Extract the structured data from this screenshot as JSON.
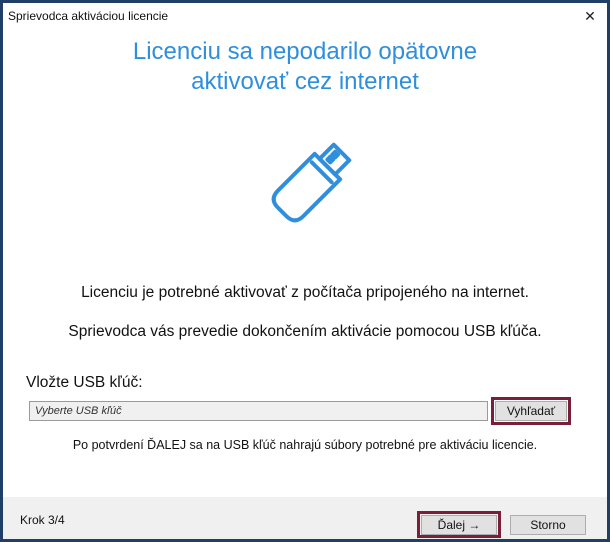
{
  "window": {
    "title": "Sprievodca aktiváciou licencie",
    "close_glyph": "✕"
  },
  "headline": {
    "line1": "Licenciu sa nepodarilo opätovne",
    "line2": "aktivovať cez internet"
  },
  "illustration": {
    "icon": "usb-drive-icon",
    "color": "#2f8fdc"
  },
  "info": {
    "line1": "Licenciu je potrebné aktivovať z počítača pripojeného na internet.",
    "line2": "Sprievodca vás prevedie dokončením aktivácie pomocou USB kľúča."
  },
  "usb": {
    "label": "Vložte USB kľúč:",
    "select_value": "Vyberte USB kľúč",
    "search_button": "Vyhľadať"
  },
  "confirm_note": "Po potvrdení ĎALEJ sa na USB kľúč nahrajú súbory potrebné pre aktiváciu licencie.",
  "footer": {
    "step": "Krok 3/4",
    "next_button": "Ďalej →",
    "cancel_button": "Storno"
  },
  "colors": {
    "accent": "#2f8fdc",
    "highlight": "#7a1f3a",
    "frame": "#1f3f66"
  }
}
